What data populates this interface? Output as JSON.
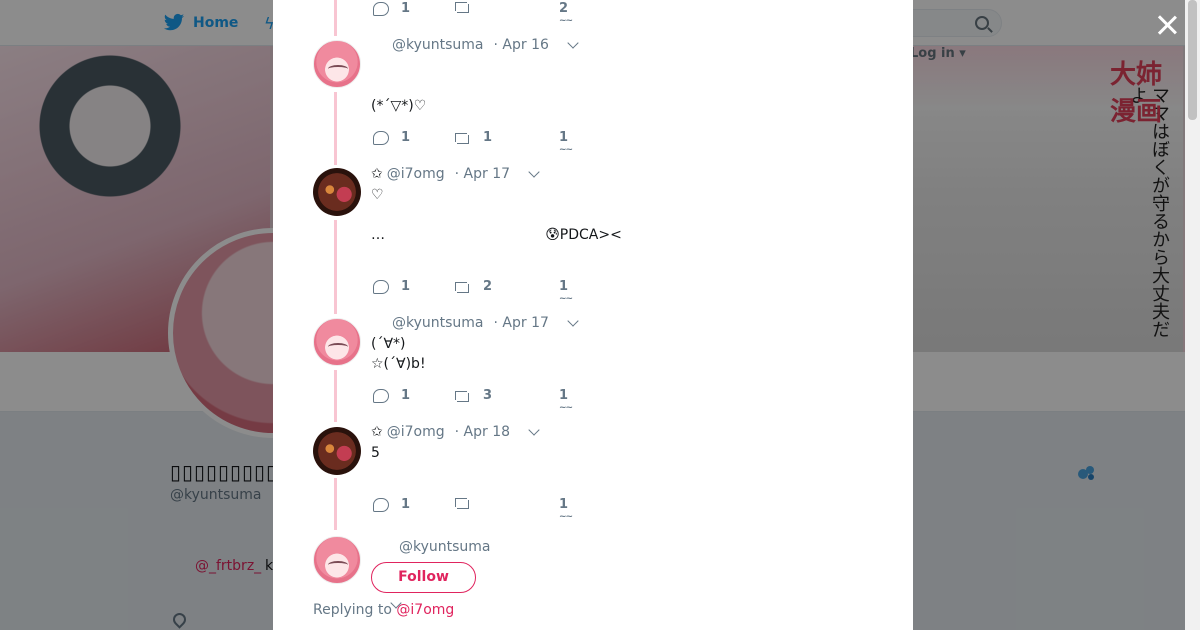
{
  "nav": {
    "home_label": "Home",
    "login_label": "Log in"
  },
  "banner": {
    "manga_text": "ママはぼくが守るから大丈夫だよ",
    "red_text": "大姉漫画"
  },
  "profile": {
    "name": "▯▯▯▯▯▯▯▯▯▯▯",
    "handle": "@kyuntsuma",
    "bio_link": "@_frtbrz_",
    "bio_rest": "k"
  },
  "thread": {
    "tweets": [
      {
        "id": "t0",
        "replies": "1",
        "retweets": "",
        "likes": "2"
      },
      {
        "id": "t1",
        "star": "",
        "handle": "@kyuntsuma",
        "date": "· Apr 16",
        "body": "(*´▽*)♡",
        "replies": "1",
        "retweets": "1",
        "likes": "1"
      },
      {
        "id": "t2",
        "star": "✩",
        "handle": "@i7omg",
        "date": "· Apr 17",
        "body_line1": "♡",
        "body_line2": "…                                    😰PDCA><",
        "replies": "1",
        "retweets": "2",
        "likes": "1"
      },
      {
        "id": "t3",
        "star": "",
        "handle": "@kyuntsuma",
        "date": "· Apr 17",
        "body": "(´∀*)\n☆(´∀)b!",
        "replies": "1",
        "retweets": "3",
        "likes": "1"
      },
      {
        "id": "t4",
        "star": "✩",
        "handle": "@i7omg",
        "date": "· Apr 18",
        "body": "5",
        "replies": "1",
        "retweets": "",
        "likes": "1"
      }
    ],
    "main_tweet": {
      "handle": "@kyuntsuma",
      "follow_label": "Follow",
      "replying_prefix": "Replying to",
      "replying_to": "@i7omg"
    }
  },
  "like_mark": "~~"
}
